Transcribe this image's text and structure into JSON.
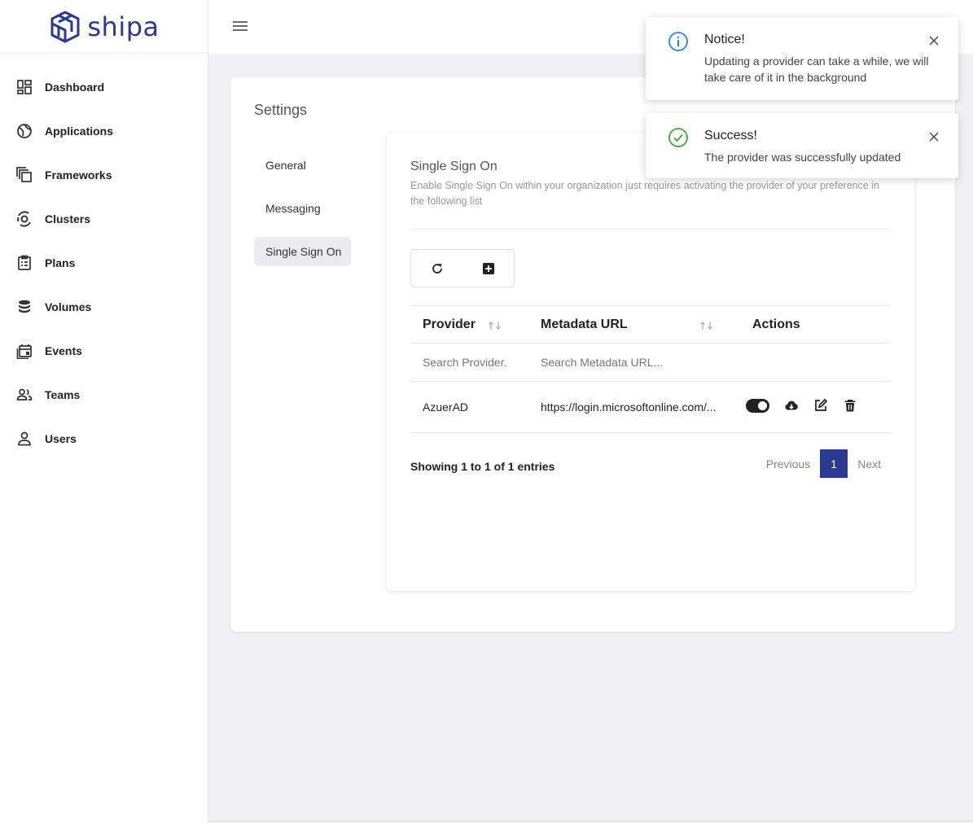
{
  "brand": {
    "name": "shipa",
    "color": "#2b3990"
  },
  "sidebar": {
    "items": [
      {
        "label": "Dashboard",
        "icon": "dashboard-icon"
      },
      {
        "label": "Applications",
        "icon": "applications-icon"
      },
      {
        "label": "Frameworks",
        "icon": "frameworks-icon"
      },
      {
        "label": "Clusters",
        "icon": "clusters-icon"
      },
      {
        "label": "Plans",
        "icon": "plans-icon"
      },
      {
        "label": "Volumes",
        "icon": "volumes-icon"
      },
      {
        "label": "Events",
        "icon": "events-icon"
      },
      {
        "label": "Teams",
        "icon": "teams-icon"
      },
      {
        "label": "Users",
        "icon": "users-icon"
      }
    ]
  },
  "settings": {
    "title": "Settings",
    "tabs": [
      {
        "label": "General",
        "active": false
      },
      {
        "label": "Messaging",
        "active": false
      },
      {
        "label": "Single Sign On",
        "active": true
      }
    ]
  },
  "sso": {
    "title": "Single Sign On",
    "description": "Enable Single Sign On within your organization just requires activating the provider of your preference in the following list",
    "toolbar": {
      "refresh_icon": "refresh-icon",
      "add_icon": "add-box-icon"
    },
    "table": {
      "columns": [
        "Provider",
        "Metadata URL",
        "Actions"
      ],
      "filters": {
        "provider_placeholder": "Search Provider.",
        "metadata_placeholder": "Search Metadata URL..."
      },
      "rows": [
        {
          "provider": "AzuerAD",
          "metadata_url": "https://login.microsoftonline.com/...",
          "enabled": true
        }
      ]
    },
    "footer": {
      "showing": "Showing 1 to 1 of 1 entries",
      "previous": "Previous",
      "current_page": "1",
      "next": "Next"
    }
  },
  "toasts": [
    {
      "type": "info",
      "title": "Notice!",
      "message": "Updating a provider can take a while, we will take care of it in the background",
      "color": "#2f80ed"
    },
    {
      "type": "success",
      "title": "Success!",
      "message": "The provider was successfully updated",
      "color": "#3aa53a"
    }
  ]
}
